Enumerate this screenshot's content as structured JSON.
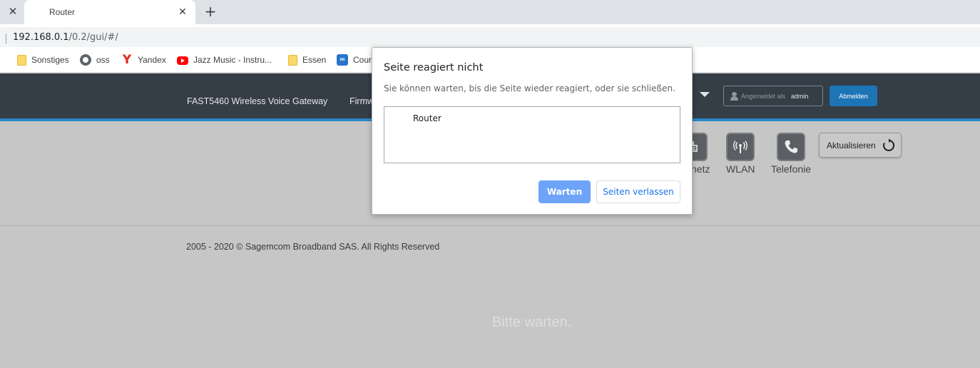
{
  "browser": {
    "tab_title": "Router",
    "url_host": "192.168.0.1",
    "url_path": "/0.2/gui/#/",
    "bookmarks": [
      {
        "label": "Sonstiges",
        "icon": "folder-icon"
      },
      {
        "label": "oss",
        "icon": "globe-icon"
      },
      {
        "label": "Yandex",
        "icon": "yandex-icon"
      },
      {
        "label": "Jazz Music - Instru...",
        "icon": "youtube-icon"
      },
      {
        "label": "Essen",
        "icon": "folder-icon"
      },
      {
        "label": "Cour",
        "icon": "coursera-icon"
      }
    ]
  },
  "router": {
    "product_name": "FAST5460 Wireless Voice Gateway",
    "firmware_link": "Firmw",
    "login_label": "Angemeldet als",
    "login_user": "admin",
    "logout_label": "Abmelden",
    "nav": [
      {
        "label": "netz",
        "icon": "router-icon"
      },
      {
        "label": "WLAN",
        "icon": "wifi-icon"
      },
      {
        "label": "Telefonie",
        "icon": "phone-icon"
      }
    ],
    "refresh_label": "Aktualisieren",
    "footer": "2005 - 2020 © Sagemcom Broadband SAS. All Rights Reserved",
    "wait_text": "Bitte warten."
  },
  "dialog": {
    "title": "Seite reagiert nicht",
    "message": "Sie können warten, bis die Seite wieder reagiert, oder sie schließen.",
    "pages": [
      "Router"
    ],
    "wait_button": "Warten",
    "leave_button": "Seiten verlassen"
  },
  "colors": {
    "header_bg": "#353d47",
    "accent_line": "#2a86c6",
    "logout_btn": "#1d75b6",
    "dialog_primary": "#6ea4f8",
    "dialog_link": "#1a73e8"
  }
}
